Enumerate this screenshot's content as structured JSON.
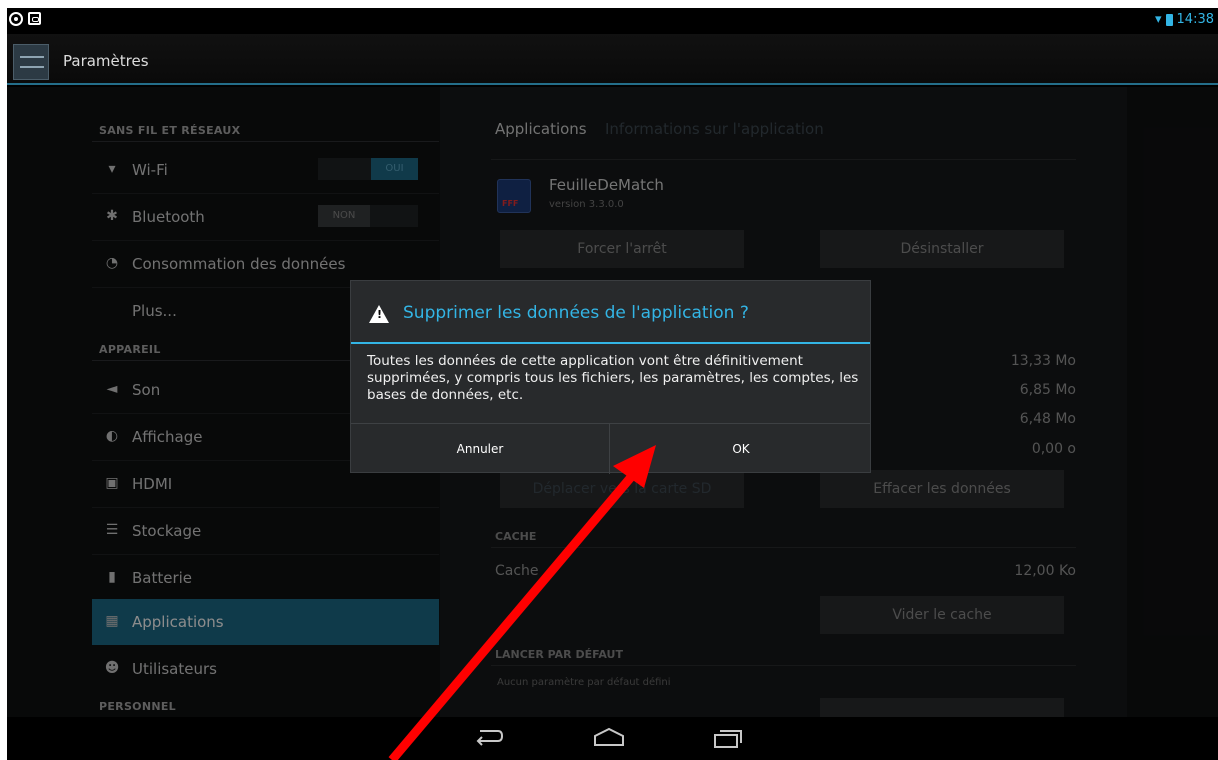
{
  "status_bar": {
    "time": "14:38"
  },
  "action_bar": {
    "title": "Paramètres"
  },
  "settings": {
    "wireless_header": "SANS FIL ET RÉSEAUX",
    "wifi": {
      "label": "Wi-Fi",
      "toggle": "OUI"
    },
    "bluetooth": {
      "label": "Bluetooth",
      "toggle": "NON"
    },
    "data_usage": "Consommation des données",
    "more": "Plus...",
    "device_header": "APPAREIL",
    "sound": "Son",
    "display": "Affichage",
    "hdmi": "HDMI",
    "storage": "Stockage",
    "battery": "Batterie",
    "applications": "Applications",
    "users": "Utilisateurs",
    "personal_header": "PERSONNEL"
  },
  "app_info": {
    "breadcrumb_root": "Applications",
    "breadcrumb_current": "Informations sur l'application",
    "app_name": "FeuilleDeMatch",
    "version": "version 3.3.0.0",
    "force_stop": "Forcer l'arrêt",
    "uninstall": "Désinstaller",
    "storage_values": [
      "13,33 Mo",
      "6,85 Mo",
      "6,48 Mo",
      "0,00 o"
    ],
    "move_sd": "Déplacer vers la carte SD",
    "clear_data": "Effacer les données",
    "cache_header": "CACHE",
    "cache_label": "Cache",
    "cache_value": "12,00 Ko",
    "clear_cache": "Vider le cache",
    "launch_header": "LANCER PAR DÉFAUT",
    "no_defaults": "Aucun paramètre par défaut défini"
  },
  "dialog": {
    "title": "Supprimer les données de l'application ?",
    "message": "Toutes les données de cette application vont être définitivement supprimées, y compris tous les fichiers, les paramètres, les comptes, les bases de données, etc.",
    "cancel": "Annuler",
    "ok": "OK"
  },
  "colors": {
    "accent": "#33b5e5",
    "annotation_arrow": "#ff0000",
    "selected": "#1d6a87"
  }
}
